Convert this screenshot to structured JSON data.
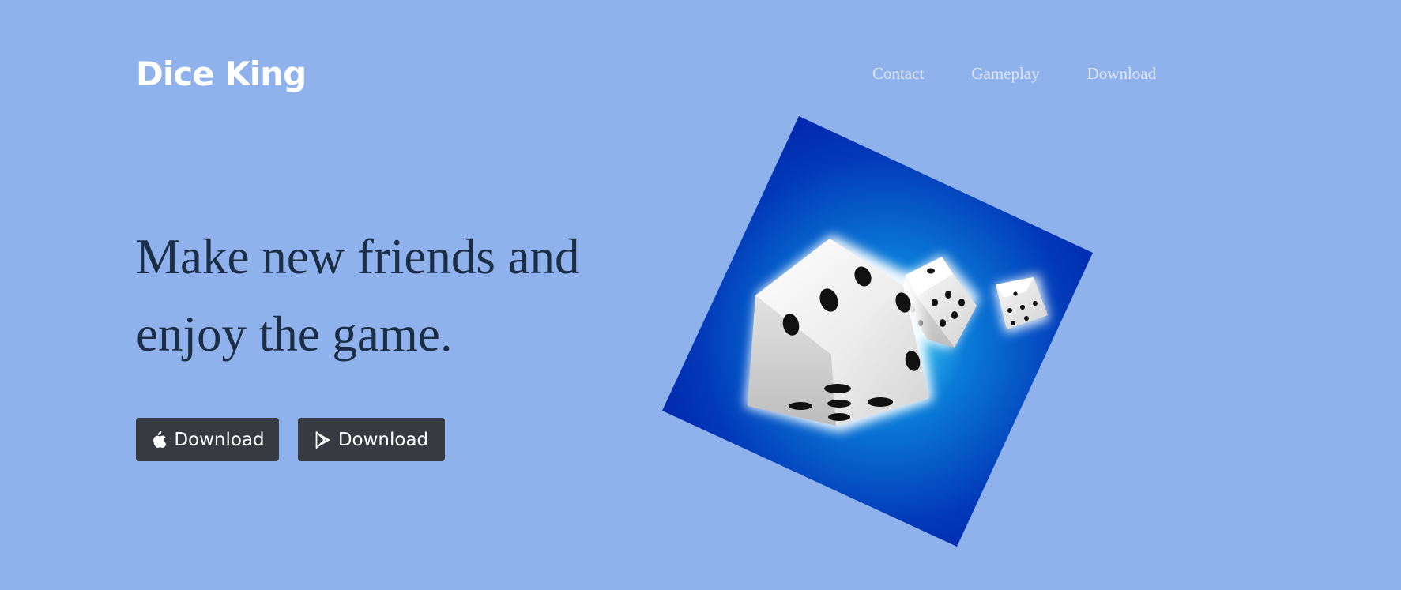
{
  "header": {
    "brand": "Dice King",
    "nav": [
      {
        "label": "Contact"
      },
      {
        "label": "Gameplay"
      },
      {
        "label": "Download"
      }
    ]
  },
  "hero": {
    "headline": "Make new friends and enjoy the game.",
    "buttons": [
      {
        "label": "Download",
        "icon": "apple-icon"
      },
      {
        "label": "Download",
        "icon": "google-play-icon"
      }
    ]
  },
  "colors": {
    "background": "#90b2ec",
    "button": "#373b41",
    "headline": "#1b2e45",
    "nav_text": "#dfe6f5",
    "art_blue": "#0022aa"
  }
}
